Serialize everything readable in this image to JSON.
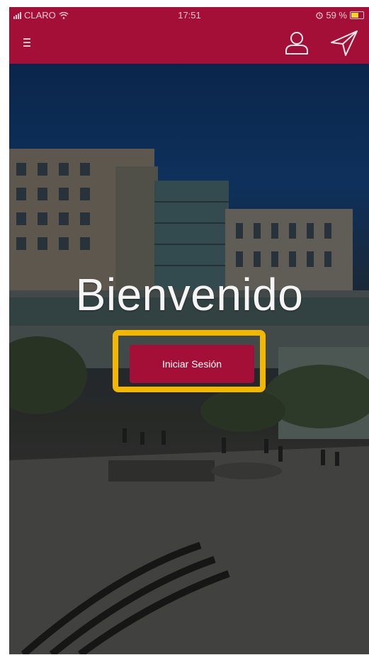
{
  "status_bar": {
    "carrier": "CLARO",
    "time": "17:51",
    "battery": "59 %",
    "icons": [
      "signal-icon",
      "wifi-icon",
      "alarm-icon",
      "battery-icon"
    ]
  },
  "app_bar": {
    "menu_icon": "hamburger-menu-icon",
    "user_icon": "user-profile-icon",
    "send_icon": "paper-plane-icon",
    "color": "#a30f37"
  },
  "hero": {
    "welcome_text": "Bienvenido",
    "login_button": "Iniciar Sesión",
    "highlight_color": "#f2b800"
  }
}
